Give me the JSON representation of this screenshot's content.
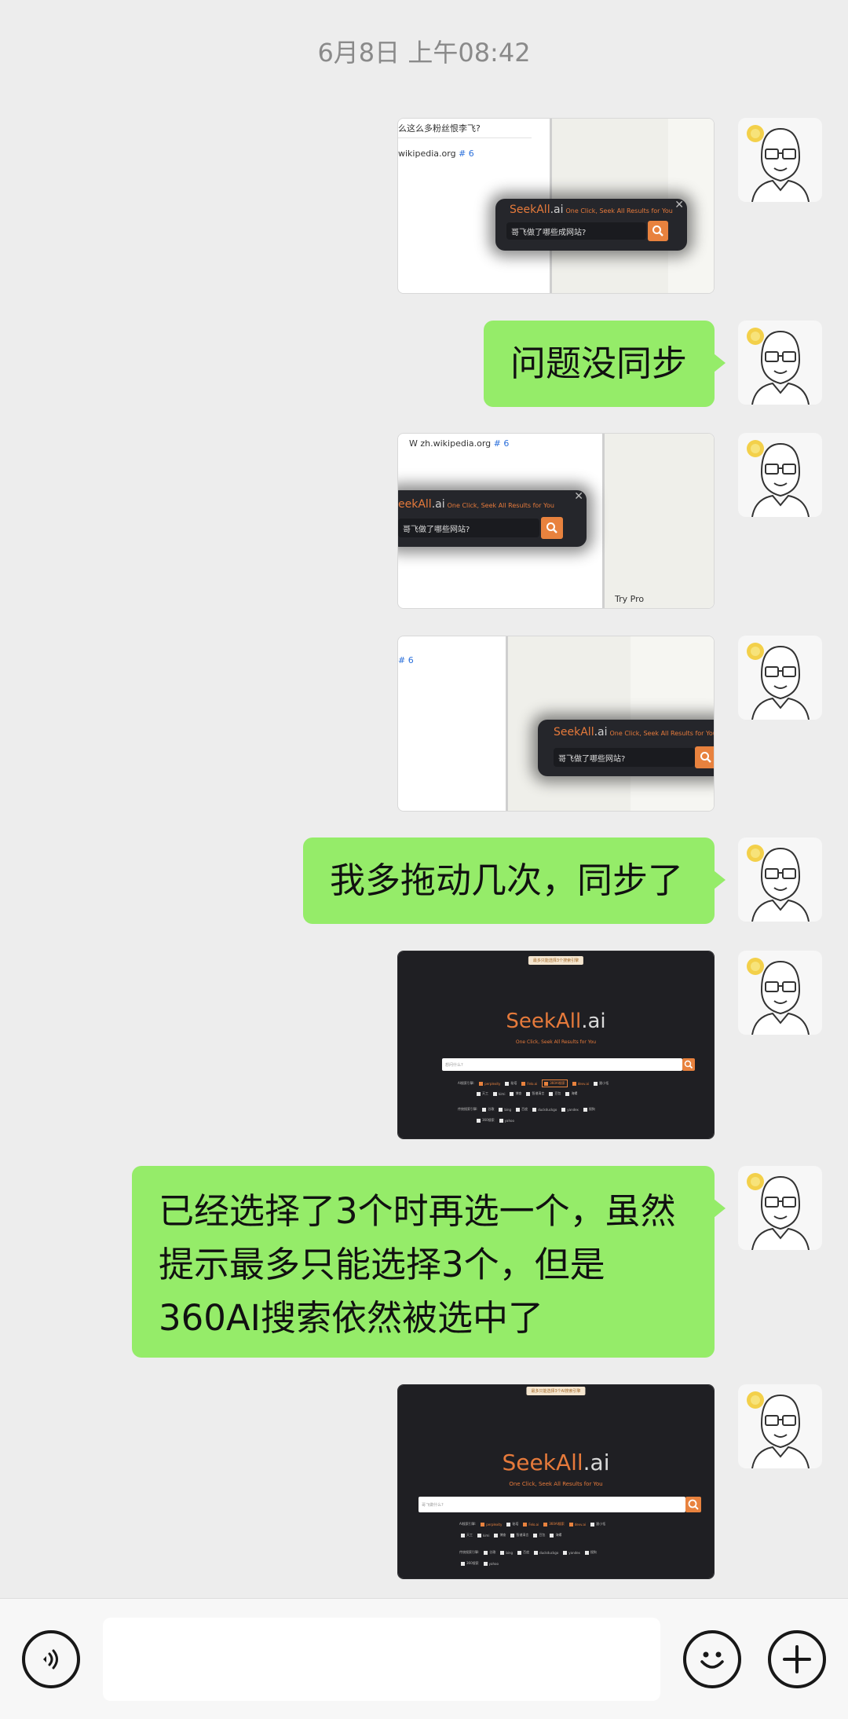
{
  "chat": {
    "timestamp": "6月8日 上午08:42",
    "messages": {
      "m1": {
        "line1": "么这么多粉丝恨李飞?",
        "domain": "wikipedia.org",
        "hash": "# 6",
        "logo": "SeekAll",
        "logo_ai": ".ai",
        "tagline": "One Click, Seek All Results for You",
        "query": "哥飞做了哪些成网站?",
        "close": "✕"
      },
      "m2": {
        "text": "问题没同步"
      },
      "m3": {
        "domain": "W  zh.wikipedia.org",
        "hash": "# 6",
        "logo": "eekAll",
        "logo_ai": ".ai",
        "tagline": "One Click, Seek All Results for You",
        "query": "哥飞做了哪些网站?",
        "close": "✕",
        "trypro": "Try Pro"
      },
      "m4": {
        "hash": "# 6",
        "logo": "SeekAll",
        "logo_ai": ".ai",
        "tagline": "One Click, Seek All Results for You",
        "query": "哥飞做了哪些网站?"
      },
      "m5": {
        "text": "我多拖动几次，同步了"
      },
      "m6": {
        "notice": "最多只能选择3个搜索引擎",
        "logo": "SeekAll",
        "logo_ai": ".ai",
        "tagline": "One Click, Seek All Results for You",
        "placeholder": "想问什么?",
        "row1": [
          "AI搜索引擎:",
          "perplexity",
          "秘塔",
          "Felo.ai",
          "360AI搜索",
          "devv.ai",
          "跟小瓴"
        ],
        "row2": [
          "天工",
          "kimi",
          "博查",
          "智谱清言",
          "豆包",
          "海螺"
        ],
        "row3": [
          "传统搜索引擎:",
          "谷歌",
          "bing",
          "百度",
          "duckduckgo",
          "yandex",
          "搜狗"
        ],
        "row4": [
          "360搜索",
          "yahoo"
        ]
      },
      "m7": {
        "line1": "已经选择了3个时再选一个，虽然",
        "line2": "提示最多只能选择3个，但是",
        "line3": "360AI搜索依然被选中了"
      },
      "m8": {
        "notice": "最多只能选择3个AI搜索引擎",
        "logo": "SeekAll",
        "logo_ai": ".ai",
        "tagline": "One Click, Seek All Results for You",
        "placeholder": "哥飞做什么?",
        "row1": [
          "AI搜索引擎:",
          "perplexity",
          "秘塔",
          "Felo.ai",
          "360AI搜索",
          "devv.ai",
          "跟小瓴"
        ],
        "row2": [
          "天工",
          "kimi",
          "博查",
          "智谱清言",
          "豆包",
          "海螺"
        ],
        "row3": [
          "传统搜索引擎:",
          "谷歌",
          "bing",
          "百度",
          "duckduckgo",
          "yandex",
          "搜狗"
        ],
        "row4": [
          "360搜索",
          "yahoo"
        ]
      }
    }
  },
  "input_bar": {
    "voice_icon": "voice-icon",
    "emoji_icon": "emoji-icon",
    "plus_icon": "plus-icon"
  },
  "colors": {
    "bubble": "#95ec69",
    "background": "#ededed",
    "accent": "#e8823e"
  }
}
